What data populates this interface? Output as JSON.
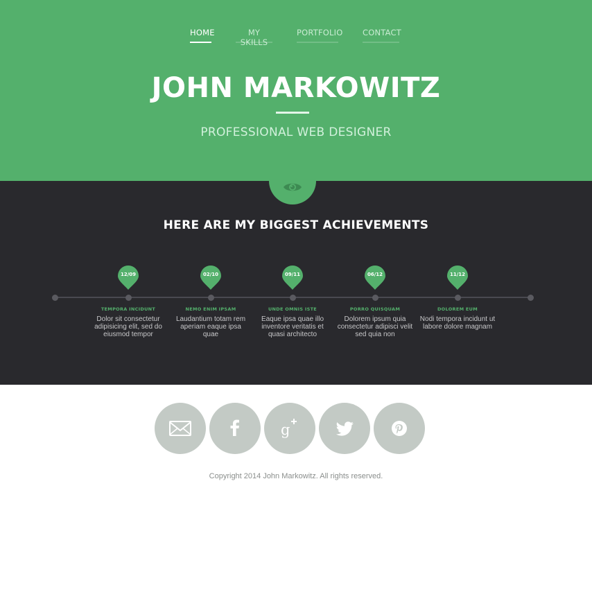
{
  "nav": {
    "items": [
      {
        "label": "HOME",
        "active": true
      },
      {
        "label": "MY SKILLS",
        "active": false
      },
      {
        "label": "PORTFOLIO",
        "active": false
      },
      {
        "label": "CONTACT",
        "active": false
      }
    ]
  },
  "hero": {
    "title": "JOHN MARKOWITZ",
    "subtitle": "PROFESSIONAL WEB DESIGNER",
    "icon": "eye-icon"
  },
  "achievements": {
    "heading": "HERE ARE MY BIGGEST ACHIEVEMENTS",
    "milestones": [
      {
        "date": "12/09",
        "title": "TEMPORA INCIDUNT",
        "text": "Dolor sit consectetur adipisicing elit, sed do eiusmod tempor"
      },
      {
        "date": "02/10",
        "title": "NEMO ENIM IPSAM",
        "text": "Laudantium totam rem aperiam eaque ipsa quae"
      },
      {
        "date": "09/11",
        "title": "UNDE OMNIS ISTE",
        "text": "Eaque ipsa quae illo inventore veritatis et quasi architecto"
      },
      {
        "date": "06/12",
        "title": "PORRO QUISQUAM",
        "text": "Dolorem ipsum quia consectetur adipisci velit sed quia non"
      },
      {
        "date": "11/12",
        "title": "DOLOREM EUM",
        "text": "Nodi tempora incidunt ut labore dolore magnam"
      }
    ]
  },
  "social": {
    "items": [
      {
        "name": "email",
        "icon": "envelope-icon"
      },
      {
        "name": "facebook",
        "icon": "facebook-icon"
      },
      {
        "name": "google-plus",
        "icon": "google-plus-icon"
      },
      {
        "name": "twitter",
        "icon": "twitter-icon"
      },
      {
        "name": "pinterest",
        "icon": "pinterest-icon"
      }
    ]
  },
  "footer": {
    "copyright": "Copyright 2014 John Markowitz. All rights reserved."
  },
  "colors": {
    "brand_green": "#54b06c",
    "dark_bg": "#29292d",
    "social_gray": "#c3cac5"
  }
}
